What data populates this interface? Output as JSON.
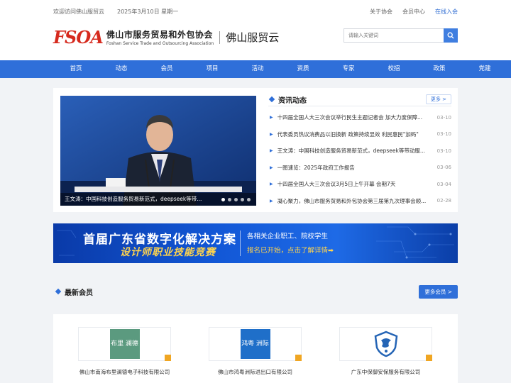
{
  "topbar": {
    "welcome": "欢迎访问佛山服贸云",
    "date": "2025年3月10日 星期一",
    "links": [
      "关于协会",
      "会员中心",
      "在线入会"
    ]
  },
  "header": {
    "logo_mark": "FSOA",
    "org_cn": "佛山市服务贸易和外包协会",
    "org_en": "Foshan Service Trade and Outsourcing Association",
    "platform": "佛山服贸云"
  },
  "search": {
    "placeholder": "请输入关键词"
  },
  "nav": [
    "首页",
    "动态",
    "会员",
    "项目",
    "活动",
    "资质",
    "专家",
    "校招",
    "政策",
    "党建"
  ],
  "slider": {
    "caption": "王文涛：中国科技创造服务贸易新范式，deepseek等带...",
    "dot_count": 5,
    "active_dot": 1
  },
  "news": {
    "title": "资讯动态",
    "more": "更多 >",
    "items": [
      {
        "title": "十四届全国人大三次会议举行民生主题记者会 加大力度保障...",
        "date": "03-10"
      },
      {
        "title": "代表委员热议消费品以旧换新 政策持续显效 利民惠民\"加码\"",
        "date": "03-10"
      },
      {
        "title": "王文涛：中国科技创造服务贸易新范式，deepseek等带动服...",
        "date": "03-10"
      },
      {
        "title": "一图速览：2025年政府工作报告",
        "date": "03-06"
      },
      {
        "title": "十四届全国人大三次会议3月5日上午开幕 会期7天",
        "date": "03-04"
      },
      {
        "title": "凝心聚力，佛山市服务贸易和外包协会第三届第九次理事会顺...",
        "date": "02-28"
      }
    ]
  },
  "banner": {
    "line1": "首届广东省数字化解决方案",
    "line2": "设计师职业技能竞赛",
    "right1": "各相关企业职工、院校学生",
    "right2": "报名已开始，点击了解详情➡"
  },
  "members": {
    "title": "最新会员",
    "more": "更多会员 >",
    "items": [
      {
        "name": "佛山市南海布里澜德电子科技有限公司",
        "logo_text": "布里 澜德",
        "logo_color": "#5b9a7f"
      },
      {
        "name": "佛山市鸿粤洲际进出口有限公司",
        "logo_text": "鸿粤 洲际",
        "logo_color": "#1f6fc9"
      },
      {
        "name": "广东中保御安保服务有限公司",
        "logo_text": "",
        "logo_color": "#2464b5"
      }
    ]
  },
  "colors": {
    "primary": "#2f6fd9",
    "brand_red": "#d62a1e",
    "accent": "#f0a623"
  }
}
